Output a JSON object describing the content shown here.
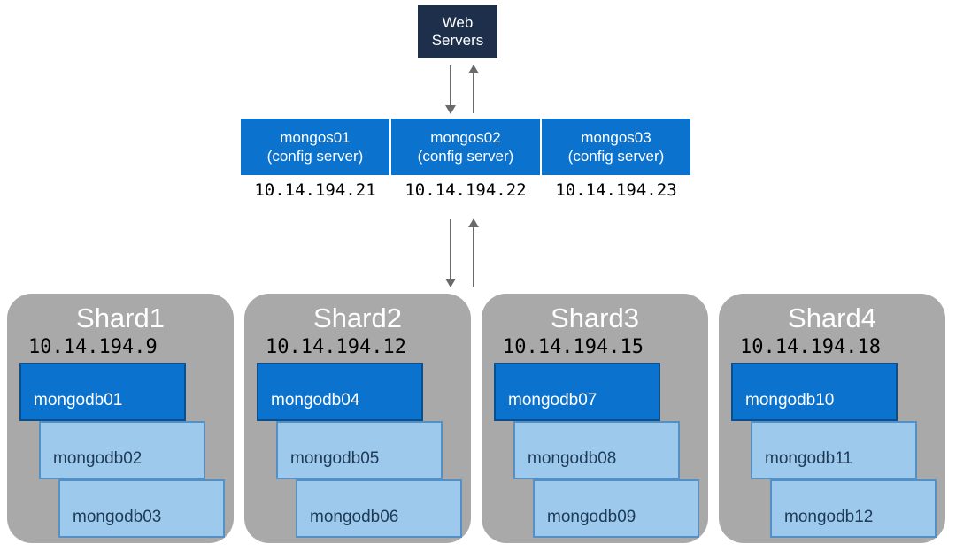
{
  "webServers": "Web\nServers",
  "mongos": [
    {
      "name": "mongos01",
      "sub": "(config server)",
      "ip": "10.14.194.21"
    },
    {
      "name": "mongos02",
      "sub": "(config server)",
      "ip": "10.14.194.22"
    },
    {
      "name": "mongos03",
      "sub": "(config server)",
      "ip": "10.14.194.23"
    }
  ],
  "shards": [
    {
      "title": "Shard1",
      "ip": "10.14.194.9",
      "dbs": [
        "mongodb01",
        "mongodb02",
        "mongodb03"
      ]
    },
    {
      "title": "Shard2",
      "ip": "10.14.194.12",
      "dbs": [
        "mongodb04",
        "mongodb05",
        "mongodb06"
      ]
    },
    {
      "title": "Shard3",
      "ip": "10.14.194.15",
      "dbs": [
        "mongodb07",
        "mongodb08",
        "mongodb09"
      ]
    },
    {
      "title": "Shard4",
      "ip": "10.14.194.18",
      "dbs": [
        "mongodb10",
        "mongodb11",
        "mongodb12"
      ]
    }
  ]
}
